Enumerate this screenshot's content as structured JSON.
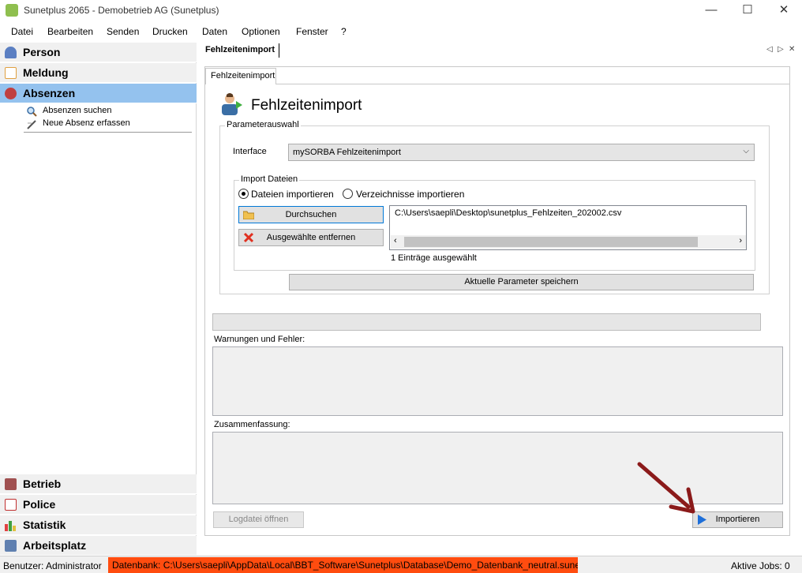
{
  "window": {
    "title": "Sunetplus 2065 - Demobetrieb AG (Sunetplus)",
    "minimize": "—",
    "maximize": "☐",
    "close": "✕"
  },
  "menu": [
    "Datei",
    "Bearbeiten",
    "Senden",
    "Drucken",
    "Daten",
    "Optionen",
    "Fenster",
    "?"
  ],
  "sidebar": {
    "top_items": [
      {
        "label": "Person",
        "icon": "person-icon",
        "color": "#5b7fc2"
      },
      {
        "label": "Meldung",
        "icon": "envelope-icon",
        "color": "#e0a040"
      },
      {
        "label": "Absenzen",
        "icon": "absence-icon",
        "color": "#c04040"
      }
    ],
    "sub_items": [
      {
        "label": "Absenzen suchen",
        "icon": "magnifier-icon"
      },
      {
        "label": "Neue Absenz erfassen",
        "icon": "pen-icon"
      }
    ],
    "bottom_items": [
      {
        "label": "Betrieb",
        "icon": "factory-icon",
        "color": "#a05050"
      },
      {
        "label": "Police",
        "icon": "document-icon",
        "color": "#c03030"
      },
      {
        "label": "Statistik",
        "icon": "bar-chart-icon",
        "color": "#40a040"
      },
      {
        "label": "Arbeitsplatz",
        "icon": "computer-icon",
        "color": "#6080b0"
      }
    ]
  },
  "doc_tab": {
    "label": "Fehlzeitenimport",
    "nav_prev": "◁",
    "nav_next": "▷",
    "nav_close": "✕"
  },
  "form": {
    "tab_label": "Fehlzeitenimport",
    "title": "Fehlzeitenimport",
    "parameter_group": "Parameterauswahl",
    "interface_label": "Interface",
    "interface_value": "mySORBA Fehlzeitenimport",
    "import_group": "Import Dateien",
    "radio_files": "Dateien importieren",
    "radio_dirs": "Verzeichnisse importieren",
    "browse_button": "Durchsuchen",
    "remove_button": "Ausgewählte entfernen",
    "file_entry": "C:\\Users\\saepli\\Desktop\\sunetplus_Fehlzeiten_202002.csv",
    "selection_count": "1 Einträge ausgewählt",
    "save_params_button": "Aktuelle Parameter speichern",
    "warnings_label": "Warnungen und Fehler:",
    "summary_label": "Zusammenfassung:",
    "logfile_button": "Logdatei öffnen",
    "import_button": "Importieren"
  },
  "status": {
    "user": "Benutzer: Administrator",
    "database": "Datenbank: C:\\Users\\saepli\\AppData\\Local\\BBT_Software\\Sunetplus\\Database\\Demo_Datenbank_neutral.sunet",
    "jobs": "Aktive Jobs: 0"
  },
  "colors": {
    "active_nav": "#94c2ee",
    "db_status": "#ff4c0f",
    "annotation_arrow": "#8b1a1a"
  }
}
